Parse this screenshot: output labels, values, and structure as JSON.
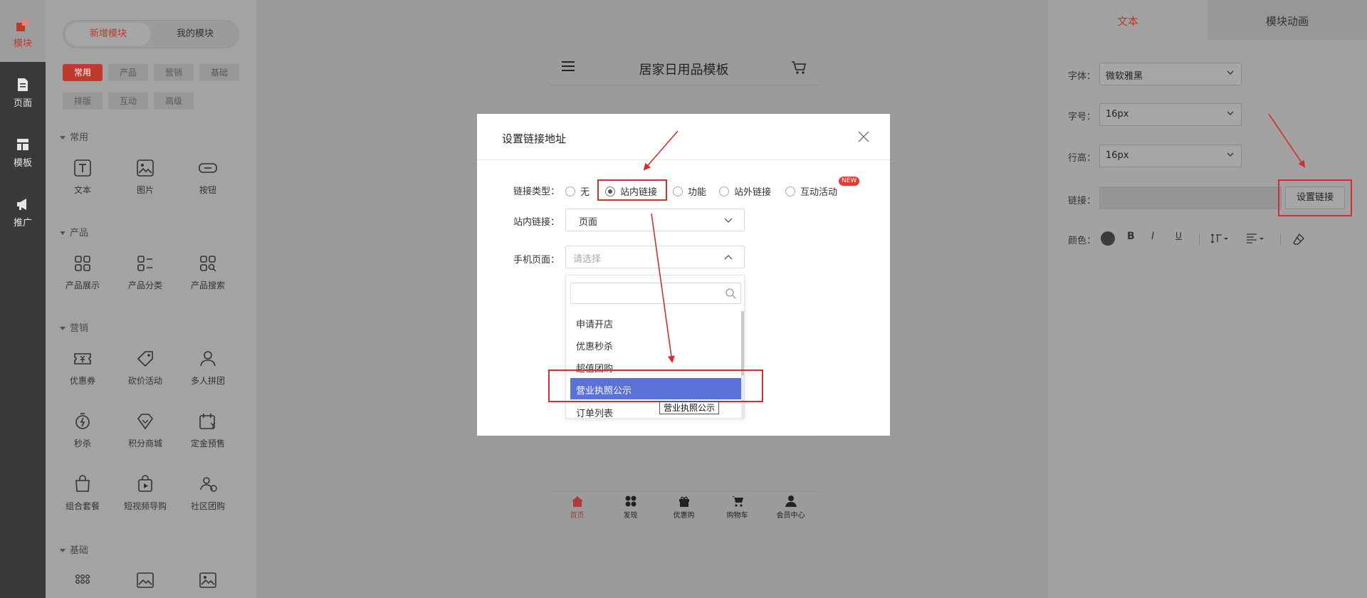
{
  "nav": {
    "items": [
      {
        "label": "模块",
        "icon": "blocks-icon",
        "active": true
      },
      {
        "label": "页面",
        "icon": "page-icon"
      },
      {
        "label": "模板",
        "icon": "template-icon"
      },
      {
        "label": "推广",
        "icon": "megaphone-icon"
      }
    ]
  },
  "modules": {
    "segments": [
      "新增模块",
      "我的模块"
    ],
    "tags": [
      "常用",
      "产品",
      "营销",
      "基础",
      "排版",
      "互动",
      "高级"
    ],
    "sections": [
      {
        "title": "常用",
        "items": [
          "文本",
          "图片",
          "按钮"
        ]
      },
      {
        "title": "产品",
        "items": [
          "产品展示",
          "产品分类",
          "产品搜索"
        ]
      },
      {
        "title": "营销",
        "items": [
          "优惠券",
          "砍价活动",
          "多人拼团",
          "秒杀",
          "积分商城",
          "定金预售",
          "组合套餐",
          "短视频导购",
          "社区团购"
        ]
      },
      {
        "title": "基础",
        "items": [
          "",
          "",
          ""
        ]
      }
    ]
  },
  "phone": {
    "title": "居家日用品模板",
    "tabs": [
      "首页",
      "发现",
      "优惠购",
      "购物车",
      "会员中心"
    ]
  },
  "right": {
    "tabs": [
      "文本",
      "模块动画"
    ],
    "font_label": "字体：",
    "font_value": "微软雅黑",
    "size_label": "字号：",
    "size_value": "16px",
    "lineheight_label": "行高：",
    "lineheight_value": "16px",
    "link_label": "链接：",
    "set_link_button": "设置链接",
    "color_label": "颜色："
  },
  "modal": {
    "title": "设置链接地址",
    "link_type_label": "链接类型：",
    "link_types": [
      "无",
      "站内链接",
      "功能",
      "站外链接",
      "互动活动"
    ],
    "selected_type": "站内链接",
    "new_badge": "NEW",
    "inner_link_label": "站内链接：",
    "inner_link_value": "页面",
    "mobile_page_label": "手机页面：",
    "mobile_page_placeholder": "请选择",
    "dropdown_items": [
      "申请开店",
      "优惠秒杀",
      "超值团购",
      "营业执照公示",
      "订单列表"
    ],
    "selected_item": "营业执照公示",
    "tooltip": "营业执照公示"
  },
  "colors": {
    "accent": "#c0392b",
    "highlight": "#5b72d8",
    "annotation": "#d32f2f"
  }
}
